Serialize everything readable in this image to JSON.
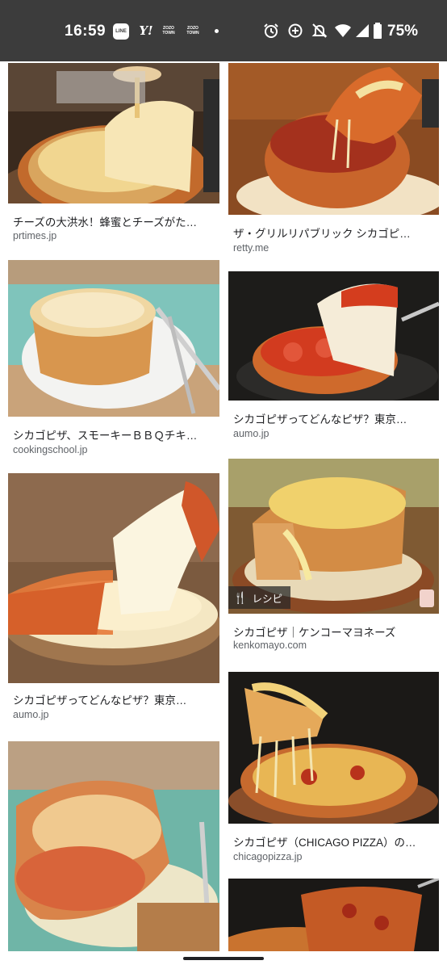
{
  "status_bar": {
    "time": "16:59",
    "line_icon_label": "LINE",
    "yahoo_icon_label": "Y!",
    "zozo_label_1": "ZOZO",
    "zozo_label_2": "TOWN",
    "battery_percent": "75%",
    "icons": [
      "line-icon",
      "yahoo-icon",
      "zozotown-icon",
      "zozotown-icon",
      "dot-icon",
      "alarm-icon",
      "data-saver-icon",
      "notifications-off-icon",
      "wifi-icon",
      "signal-icon",
      "battery-icon"
    ]
  },
  "results": {
    "left": [
      {
        "caption": "チーズの大洪水！蜂蜜とチーズがた…",
        "source": "prtimes.jp"
      },
      {
        "caption": "シカゴピザ、スモーキーＢＢＱチキ…",
        "source": "cookingschool.jp"
      },
      {
        "caption": "シカゴピザってどんなピザ？東京…",
        "source": "aumo.jp"
      },
      {
        "caption": "",
        "source": ""
      }
    ],
    "right": [
      {
        "caption": "ザ・グリルリパブリック シカゴピ…",
        "source": "retty.me"
      },
      {
        "caption": "シカゴピザってどんなピザ？東京…",
        "source": "aumo.jp"
      },
      {
        "caption": "シカゴピザ｜ケンコーマヨネーズ",
        "source": "kenkomayo.com",
        "badge": "レシピ"
      },
      {
        "caption": "シカゴピザ（CHICAGO PIZZA）の…",
        "source": "chicagopizza.jp"
      },
      {
        "caption": "",
        "source": ""
      }
    ]
  }
}
